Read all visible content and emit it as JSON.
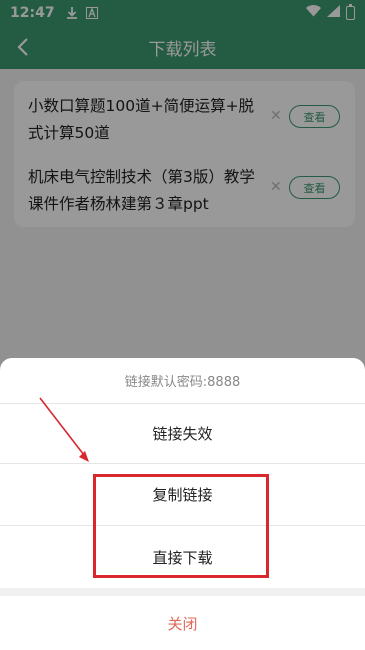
{
  "status_bar": {
    "time": "12:47",
    "icons": [
      "download-icon",
      "a-letter-icon",
      "wifi-icon",
      "signal-icon",
      "battery-icon"
    ]
  },
  "header": {
    "title": "下载列表",
    "back_icon": "chevron-left-icon"
  },
  "list": {
    "items": [
      {
        "title": "小数口算题100道+简便运算+脱式计算50道",
        "action_label": "查看"
      },
      {
        "title": "机床电气控制技术（第3版）教学课件作者杨林建第３章ppt",
        "action_label": "查看"
      }
    ]
  },
  "sheet": {
    "header_text": "链接默认密码:8888",
    "options": [
      "链接失效",
      "复制链接",
      "直接下载"
    ],
    "close_label": "关闭"
  },
  "colors": {
    "accent": "#3b9a70",
    "close_text": "#e0685a",
    "annotation": "#d8282e"
  }
}
